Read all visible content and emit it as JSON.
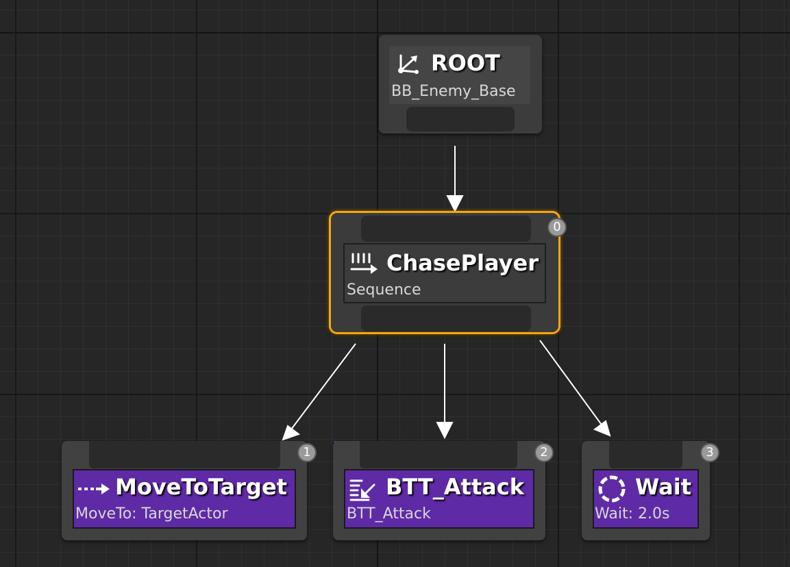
{
  "graph": {
    "root": {
      "title": "ROOT",
      "blackboard": "BB_Enemy_Base",
      "icon": "root-icon"
    },
    "composite": {
      "title": "ChasePlayer",
      "subtitle": "Sequence",
      "index": "0",
      "icon": "sequence-icon",
      "state": "selected"
    },
    "tasks": [
      {
        "title": "MoveToTarget",
        "subtitle": "MoveTo: TargetActor",
        "index": "1",
        "icon": "move-to-icon"
      },
      {
        "title": "BTT_Attack",
        "subtitle": "BTT_Attack",
        "index": "2",
        "icon": "task-icon"
      },
      {
        "title": "Wait",
        "subtitle": "Wait: 2.0s",
        "index": "3",
        "icon": "wait-icon"
      }
    ]
  },
  "colors": {
    "background": "#262626",
    "task_title": "#5f2aa6",
    "selection_outline": "#f2a80d",
    "wire": "#ffffff"
  }
}
